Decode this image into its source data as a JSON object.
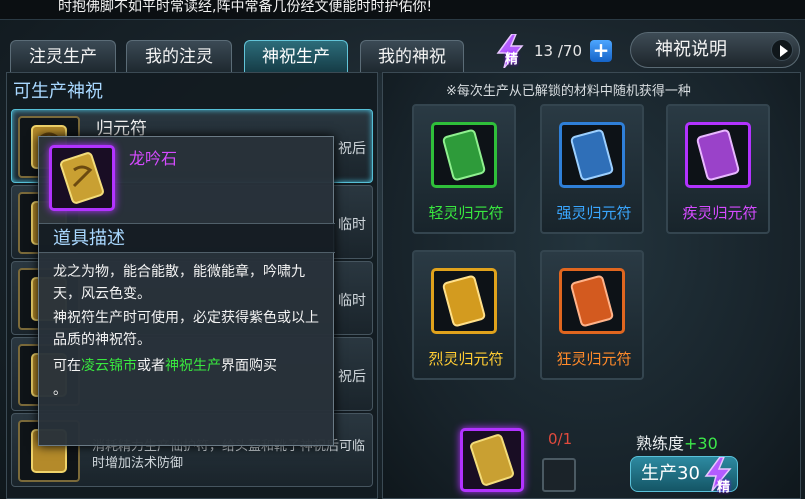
{
  "tip_text": "时抱佛脚不如平时常读经,阵中常备几份经文便能时时护佑你!",
  "tabs": [
    {
      "label": "注灵生产",
      "active": false
    },
    {
      "label": "我的注灵",
      "active": false
    },
    {
      "label": "神祝生产",
      "active": true
    },
    {
      "label": "我的神祝",
      "active": false
    }
  ],
  "energy": {
    "badge": "精",
    "count": "13 /70",
    "plus": "+"
  },
  "help_button": "神祝说明",
  "left_panel": {
    "title": "可生产神祝",
    "rows": [
      {
        "title": "归元符",
        "tail": "祝后"
      },
      {
        "title": "",
        "tail": "临时"
      },
      {
        "title": "",
        "tail": "临时"
      },
      {
        "title": "",
        "tail": "祝后"
      },
      {
        "desc": "消耗精力生产仙护符，给头盔和靴子神祝后可临时增加法术防御"
      }
    ]
  },
  "tooltip": {
    "item_name": "龙吟石",
    "section_title": "道具描述",
    "line1": "龙之为物，能合能散，能微能章，吟啸九天，风云色变。",
    "line2": "神祝符生产时可使用，必定获得紫色或以上品质的神祝符。",
    "line3_prefix": "可在",
    "line3_link1": "凌云锦市",
    "line3_mid": "或者",
    "line3_link2": "神祝生产",
    "line3_suffix": "界面购买",
    "line4": "。"
  },
  "right_panel": {
    "note": "※每次生产从已解锁的材料中随机获得一种",
    "slots": [
      {
        "label": "轻灵归元符",
        "color": "#39e83f",
        "frame": "#2fbf3a",
        "card": "#2e9b3a"
      },
      {
        "label": "强灵归元符",
        "color": "#3aa7ff",
        "frame": "#2f7fd8",
        "card": "#2f6fb8"
      },
      {
        "label": "疾灵归元符",
        "color": "#d54bff",
        "frame": "#b233ff",
        "card": "#9a42c9"
      },
      {
        "label": "烈灵归元符",
        "color": "#ffcc33",
        "frame": "#e0a21c",
        "card": "#d39b1f"
      },
      {
        "label": "狂灵归元符",
        "color": "#ff8a2a",
        "frame": "#e0661f",
        "card": "#d35a1f"
      }
    ]
  },
  "production": {
    "count": "0/1",
    "proficiency_label": "熟练度",
    "proficiency_value": "+30",
    "produce_button": "生产30",
    "badge": "精"
  }
}
